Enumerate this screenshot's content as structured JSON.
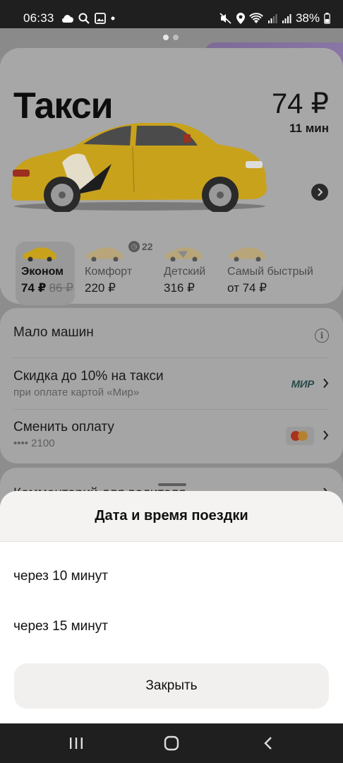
{
  "status_bar": {
    "time": "06:33",
    "battery": "38%",
    "left_icons": [
      "cloud-icon",
      "search-icon",
      "image-icon",
      "dot-icon"
    ],
    "right_icons": [
      "mute-icon",
      "location-icon",
      "wifi-icon",
      "signal-icon",
      "signal-icon",
      "battery-icon"
    ]
  },
  "app": {
    "title": "Такси",
    "price": "74 ₽",
    "eta": "11 мин",
    "tariffs": [
      {
        "name": "Эконом",
        "price": "74 ₽",
        "old_price": "86 ₽",
        "selected": true
      },
      {
        "name": "Комфорт",
        "price": "220 ₽",
        "wait_badge": "22"
      },
      {
        "name": "Детский",
        "price": "316 ₽"
      },
      {
        "name": "Самый быстрый",
        "price": "от 74 ₽"
      }
    ],
    "info_rows": {
      "few_cars": "Мало машин",
      "discount_title": "Скидка до 10% на такси",
      "discount_subtitle": "при оплате картой «Мир»",
      "mir_logo": "МИР",
      "payment_title": "Сменить оплату",
      "payment_card": "•••• 2100"
    },
    "comment_row": "Комментарий для водителя"
  },
  "sheet": {
    "title": "Дата и время поездки",
    "options": [
      "через 10 минут",
      "через 15 минут"
    ],
    "close_label": "Закрыть"
  },
  "nav_bar": {
    "icons": [
      "recent-apps-icon",
      "home-icon",
      "back-icon"
    ]
  },
  "colors": {
    "overlay_dim": "#8d8d8d",
    "taxi_yellow": "#c9a21c",
    "sheet_background": "#ffffff",
    "button_background": "#f1f0ee"
  }
}
